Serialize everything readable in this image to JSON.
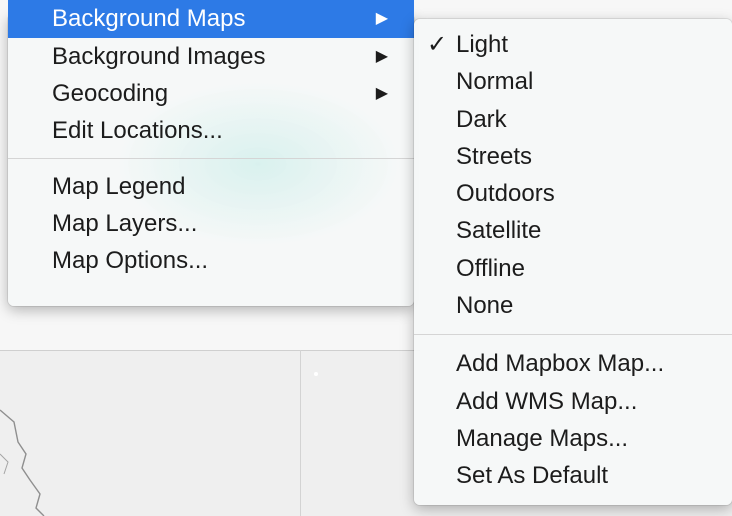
{
  "main_menu": {
    "items": [
      {
        "label": "Background Maps",
        "submenu_arrow": "▶",
        "selected": true
      },
      {
        "label": "Background Images",
        "submenu_arrow": "▶"
      },
      {
        "label": "Geocoding",
        "submenu_arrow": "▶"
      },
      {
        "label": "Edit Locations..."
      }
    ],
    "items_group2": [
      {
        "label": "Map Legend"
      },
      {
        "label": "Map Layers..."
      },
      {
        "label": "Map Options..."
      }
    ]
  },
  "submenu": {
    "checkmark": "✓",
    "styles": [
      {
        "label": "Light",
        "checked": true
      },
      {
        "label": "Normal"
      },
      {
        "label": "Dark"
      },
      {
        "label": "Streets"
      },
      {
        "label": "Outdoors"
      },
      {
        "label": "Satellite"
      },
      {
        "label": "Offline"
      },
      {
        "label": "None"
      }
    ],
    "actions": [
      {
        "label": "Add Mapbox Map..."
      },
      {
        "label": "Add WMS Map..."
      },
      {
        "label": "Manage Maps..."
      },
      {
        "label": "Set As Default"
      }
    ]
  },
  "colors": {
    "highlight": "#2d7ae6",
    "menu_bg": "#f6f8f8",
    "text": "#1c1c1c"
  }
}
